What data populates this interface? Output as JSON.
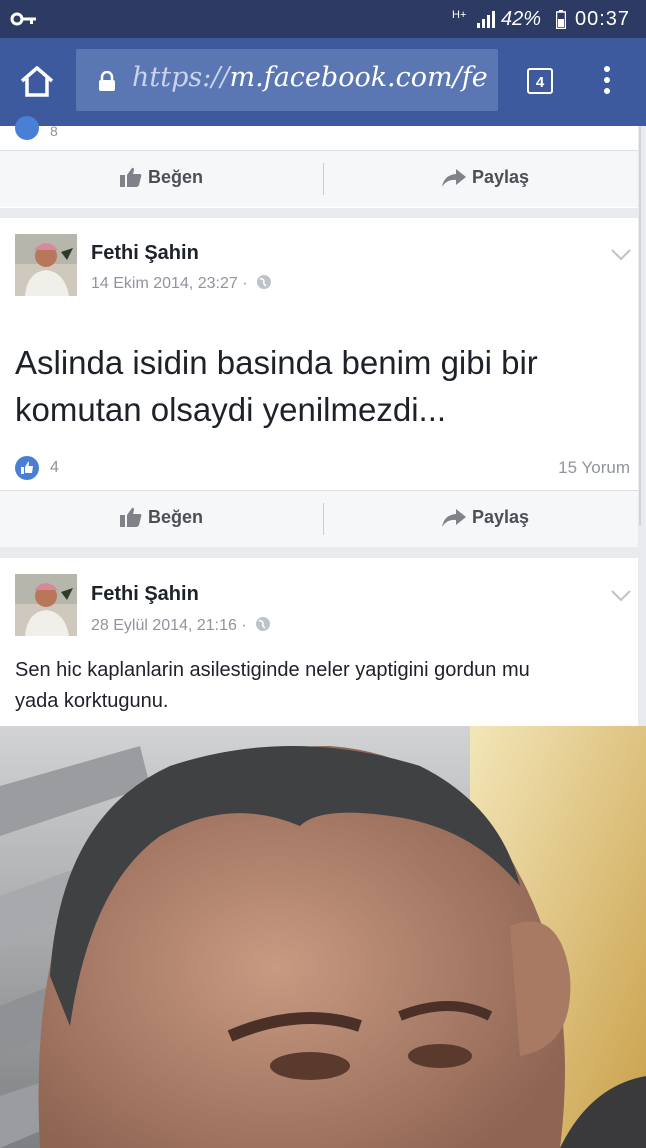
{
  "status_bar": {
    "network": "H+",
    "battery_pct": "42%",
    "time": "00:37"
  },
  "browser": {
    "url_scheme": "https://",
    "url_rest": "m.facebook.com/fe",
    "tab_count": "4",
    "icons": [
      "key-icon",
      "signal-icon",
      "battery-icon",
      "home-icon",
      "lock-icon",
      "menu-icon"
    ]
  },
  "top_post": {
    "likes": "8",
    "like_label": "Beğen",
    "share_label": "Paylaş"
  },
  "post1": {
    "author": "Fethi Şahin",
    "timestamp": "14 Ekim 2014, 23:27 ·",
    "text_line1": "Aslinda isidin basinda benim gibi bir",
    "text_line2": "komutan olsaydi yenilmezdi...",
    "likes": "4",
    "comments": "15 Yorum",
    "like_label": "Beğen",
    "share_label": "Paylaş"
  },
  "post2": {
    "author": "Fethi Şahin",
    "timestamp": "28 Eylül 2014, 21:16 ·",
    "text_line1": "Sen hic kaplanlarin asilestiginde neler yaptigini gordun mu",
    "text_line2": "yada korktugunu."
  },
  "colors": {
    "status_bar": "#2c3a64",
    "browser_bar": "#3d5a9e",
    "like_blue": "#4a7fd6"
  }
}
